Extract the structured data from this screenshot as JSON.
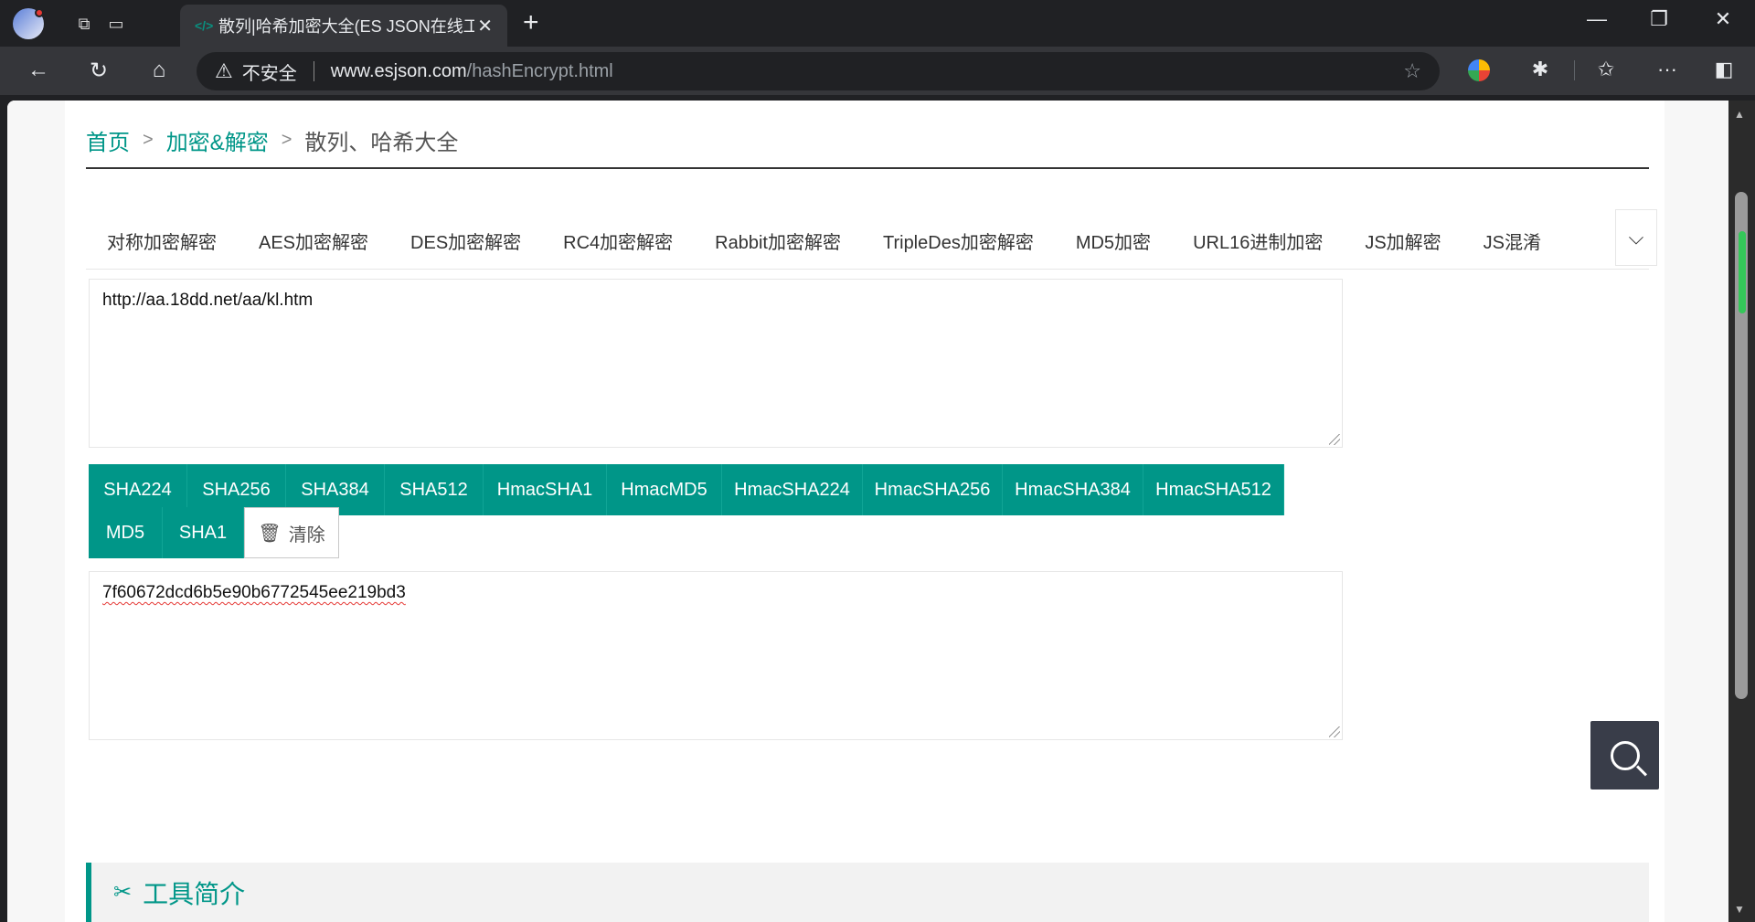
{
  "browser": {
    "tab_title": "散列|哈希加密大全(ES JSON在线工",
    "tab_favicon": "</>",
    "new_tab": "+",
    "insecure_label": "不安全",
    "url_host": "www.esjson.com",
    "url_path": "/hashEncrypt.html"
  },
  "breadcrumb": {
    "home": "首页",
    "category": "加密&解密",
    "current": "散列、哈希大全",
    "sep": ">"
  },
  "tabs": [
    "对称加密解密",
    "AES加密解密",
    "DES加密解密",
    "RC4加密解密",
    "Rabbit加密解密",
    "TripleDes加密解密",
    "MD5加密",
    "URL16进制加密",
    "JS加解密",
    "JS混淆"
  ],
  "input": {
    "value": "http://aa.18dd.net/aa/kl.htm"
  },
  "buttons_row1": [
    "SHA224",
    "SHA256",
    "SHA384",
    "SHA512",
    "HmacSHA1",
    "HmacMD5",
    "HmacSHA224",
    "HmacSHA256",
    "HmacSHA384",
    "HmacSHA512"
  ],
  "buttons_row2": [
    "MD5",
    "SHA1"
  ],
  "clear_label": "清除",
  "output": {
    "value": "7f60672dcd6b5e90b6772545ee219bd3"
  },
  "intro": {
    "title": "工具简介"
  },
  "colors": {
    "primary": "#009688",
    "fab": "#393d49"
  }
}
